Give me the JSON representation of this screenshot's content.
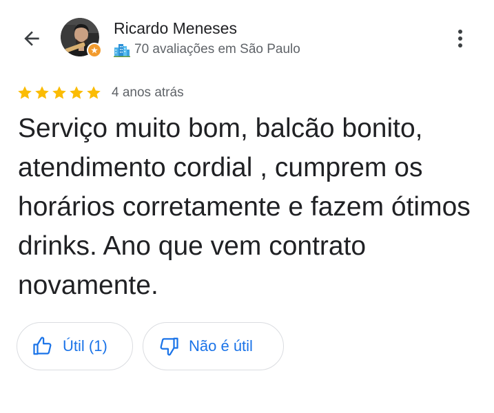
{
  "header": {
    "author_name": "Ricardo Meneses",
    "author_meta": "70 avaliações em São Paulo",
    "icons": {
      "back": "arrow-back-icon",
      "more": "more-vert-icon",
      "city": "city-icon",
      "badge": "local-guide-badge-icon"
    }
  },
  "review": {
    "rating": 5,
    "rating_max": 5,
    "date": "4 anos atrás",
    "text": "Serviço muito bom, balcão bonito, atendimento cordial , cumprem os horários corretamente e fazem ótimos drinks. Ano que vem contrato novamente."
  },
  "actions": {
    "helpful_label": "Útil (1)",
    "not_helpful_label": "Não é útil",
    "icons": {
      "helpful": "thumb-up-icon",
      "not_helpful": "thumb-down-icon"
    }
  },
  "colors": {
    "star": "#fbbc04",
    "accent_blue": "#1a73e8",
    "text_primary": "#202124",
    "text_secondary": "#5f6368",
    "button_border": "#dadce0",
    "badge": "#f29b2e"
  }
}
